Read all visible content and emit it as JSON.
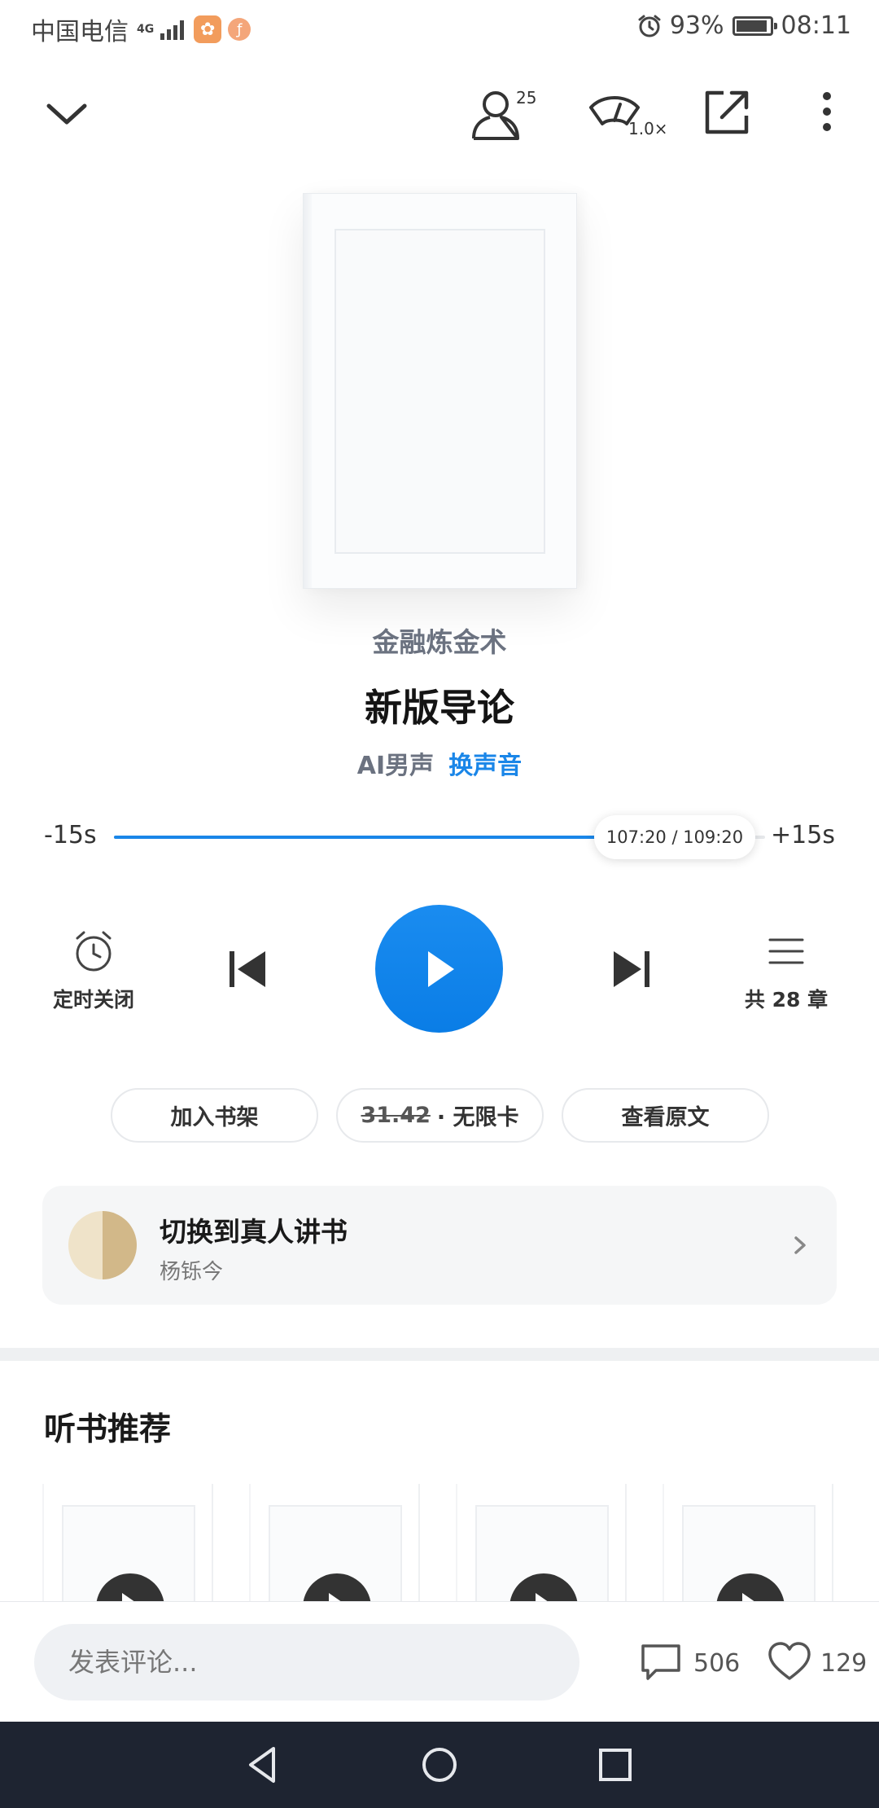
{
  "status_bar": {
    "carrier": "中国电信",
    "network": "4G",
    "battery_percent": "93%",
    "battery_level": 0.93,
    "time": "08:11"
  },
  "toolbar": {
    "listeners_count": "25",
    "speed": "1.0×"
  },
  "book": {
    "title": "金融炼金术",
    "chapter": "新版导论",
    "voice": "AI男声",
    "switch_voice_label": "换声音"
  },
  "progress": {
    "skip_back_label": "-15s",
    "skip_forward_label": "+15s",
    "time_label": "107:20 / 109:20",
    "fraction": 0.9817
  },
  "controls": {
    "timer_label": "定时关闭",
    "chapters_label": "共 28 章"
  },
  "actions": {
    "add_shelf": "加入书架",
    "price": "31.42",
    "unlimited": "· 无限卡",
    "view_original": "查看原文"
  },
  "human_reader": {
    "title": "切换到真人讲书",
    "narrator": "杨铄今"
  },
  "recommendations": {
    "title": "听书推荐"
  },
  "comment_bar": {
    "placeholder": "发表评论...",
    "comments_count": "506",
    "likes_count": "129"
  },
  "colors": {
    "accent": "#1a86e8",
    "nav_bg": "#1e2431"
  }
}
